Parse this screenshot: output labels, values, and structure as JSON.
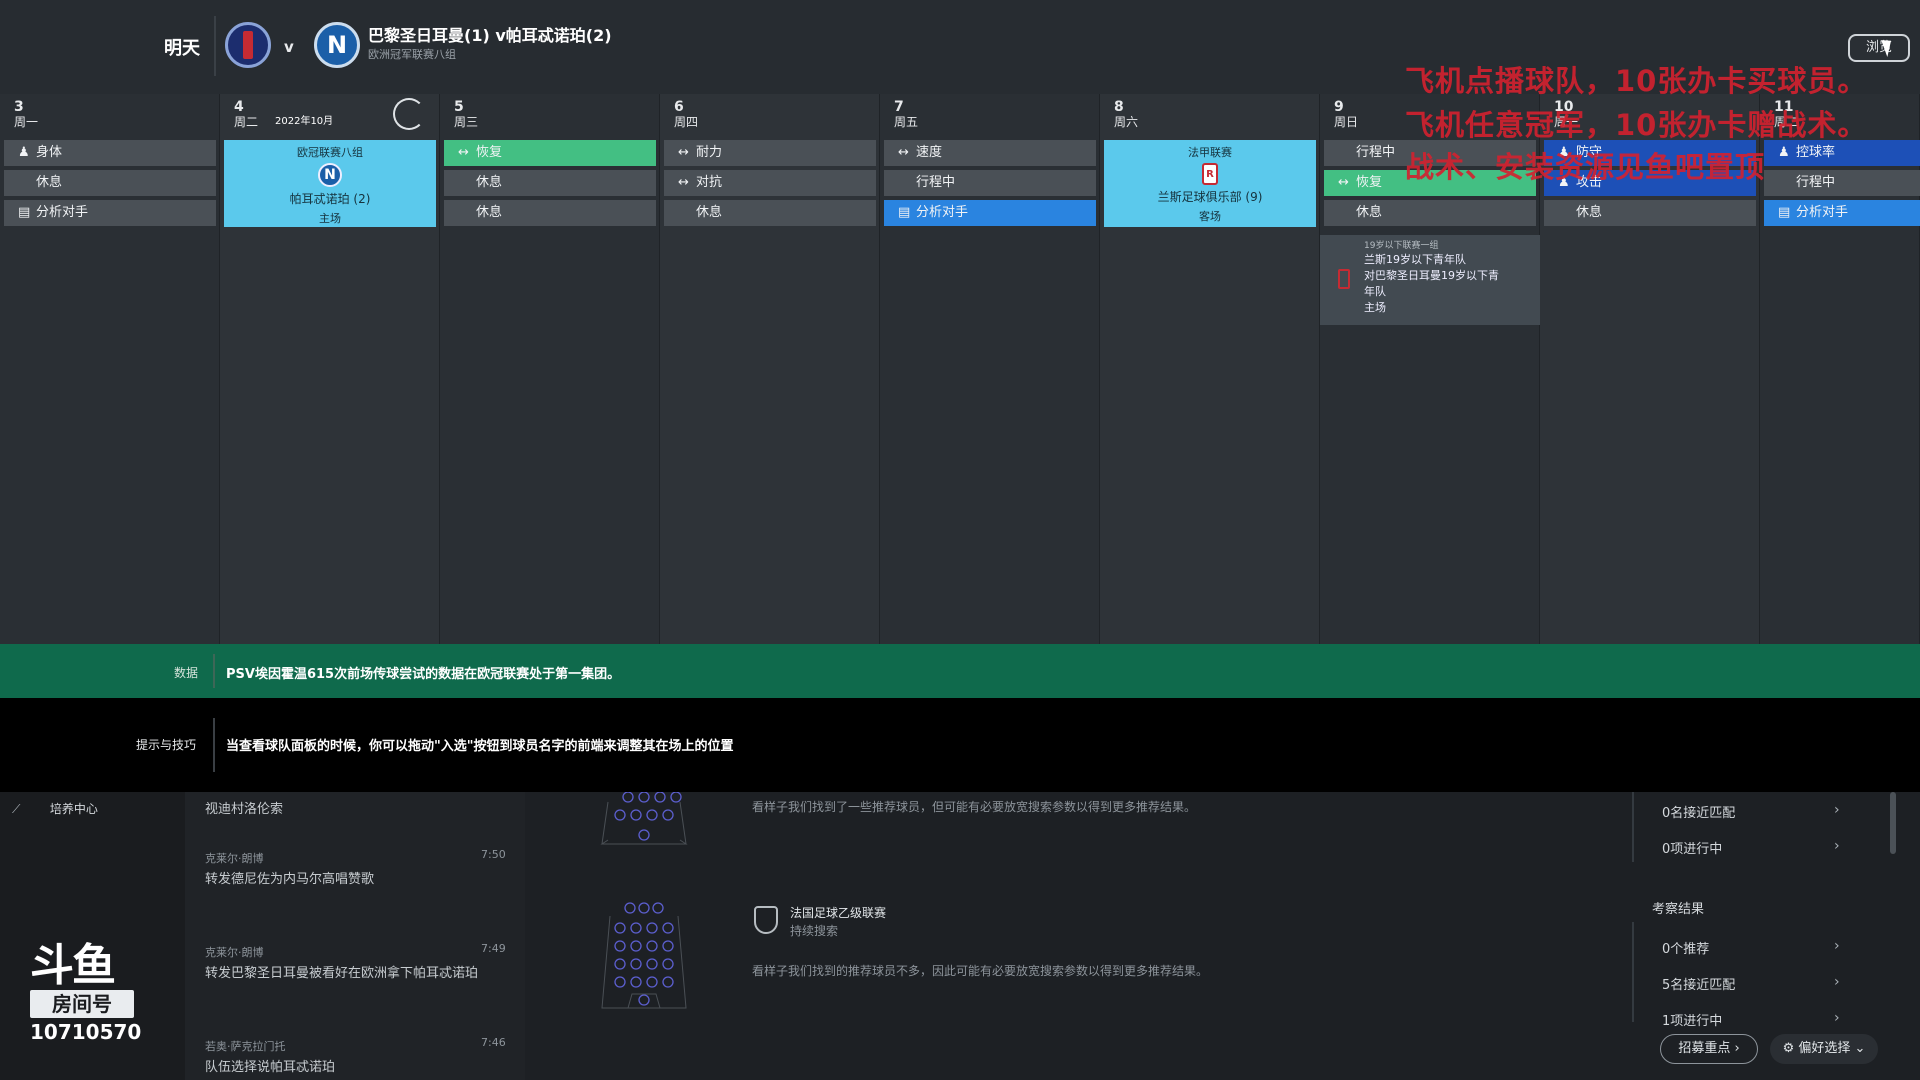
{
  "header": {
    "when": "明天",
    "vs": "v",
    "match_title": "巴黎圣日耳曼(1) v帕耳忒诺珀(2)",
    "competition": "欧洲冠军联赛八组",
    "browse_button": "浏览",
    "home_crest_icon": "psg-crest-icon",
    "away_crest_icon": "napoli-crest-icon",
    "away_crest_letter": "N"
  },
  "overlay": {
    "line1": "飞机点播球队，10张办卡买球员。",
    "line2": "飞机任意冠军，10张办卡赠战术。",
    "line3": "战术、安装资源见鱼吧置顶"
  },
  "calendar": {
    "month_label": "2022年10月",
    "days": [
      {
        "num": "3",
        "weekday": "周一",
        "rows": [
          {
            "icon": "person-icon",
            "glyph": "♟",
            "label": "身体"
          },
          {
            "label": "休息"
          },
          {
            "icon": "clipboard-icon",
            "glyph": "▤",
            "label": "分析对手"
          }
        ]
      },
      {
        "num": "4",
        "weekday": "周二",
        "match": {
          "competition": "欧冠联赛八组",
          "opponent": "帕耳忒诺珀 (2)",
          "venue": "主场",
          "badge": "N"
        }
      },
      {
        "num": "5",
        "weekday": "周三",
        "rows": [
          {
            "icon": "arrows-icon",
            "glyph": "↔",
            "label": "恢复"
          },
          {
            "label": "休息"
          },
          {
            "label": "休息"
          }
        ]
      },
      {
        "num": "6",
        "weekday": "周四",
        "rows": [
          {
            "icon": "arrows-icon",
            "glyph": "↔",
            "label": "耐力"
          },
          {
            "icon": "arrows-icon",
            "glyph": "↔",
            "label": "对抗"
          },
          {
            "label": "休息"
          }
        ]
      },
      {
        "num": "7",
        "weekday": "周五",
        "rows": [
          {
            "icon": "arrows-icon",
            "glyph": "↔",
            "label": "速度"
          },
          {
            "label": "行程中"
          },
          {
            "icon": "clipboard-icon",
            "glyph": "▤",
            "label": "分析对手"
          }
        ]
      },
      {
        "num": "8",
        "weekday": "周六",
        "match": {
          "competition": "法甲联赛",
          "opponent": "兰斯足球俱乐部 (9)",
          "venue": "客场",
          "badge": "R"
        }
      },
      {
        "num": "9",
        "weekday": "周日",
        "rows": [
          {
            "label": "行程中"
          },
          {
            "icon": "arrows-icon",
            "glyph": "↔",
            "label": "恢复"
          },
          {
            "label": "休息"
          }
        ]
      },
      {
        "num": "10",
        "weekday": "周一",
        "rows": [
          {
            "icon": "person-icon",
            "glyph": "♟",
            "label": "防守"
          },
          {
            "icon": "person-icon",
            "glyph": "♟",
            "label": "攻击"
          },
          {
            "label": "休息"
          }
        ]
      },
      {
        "num": "11",
        "weekday": "周二",
        "rows": [
          {
            "icon": "person-icon",
            "glyph": "♟",
            "label": "控球率"
          },
          {
            "label": "行程中"
          },
          {
            "icon": "clipboard-icon",
            "glyph": "▤",
            "label": "分析对手"
          }
        ]
      }
    ],
    "youth_match": {
      "group": "19岁以下联赛一组",
      "line1": "兰斯19岁以下青年队",
      "line2": "对巴黎圣日耳曼19岁以下青",
      "line3": "年队",
      "venue": "主场"
    }
  },
  "databar": {
    "label": "数据",
    "text": "PSV埃因霍温615次前场传球尝试的数据在欧冠联赛处于第一集团。"
  },
  "tipsbar": {
    "label": "提示与技巧",
    "text": "当查看球队面板的时候，你可以拖动\"入选\"按钮到球员名字的前端来调整其在场上的位置"
  },
  "sidebar": {
    "nav_item": "培养中心",
    "logo_line1": "斗鱼",
    "logo_line2": "房间号",
    "room_number": "10710570"
  },
  "news": [
    {
      "source": "",
      "time": "",
      "text": "视迪村洛伦索"
    },
    {
      "source": "克莱尔·朗博",
      "time": "7:50",
      "text": "转发德尼佐为内马尔高唱赞歌"
    },
    {
      "source": "克莱尔·朗博",
      "time": "7:49",
      "text": "转发巴黎圣日耳曼被看好在欧洲拿下帕耳忒诺珀"
    },
    {
      "source": "若奥·萨克拉门托",
      "time": "7:46",
      "text": "队伍选择说帕耳忒诺珀"
    }
  ],
  "scouting": {
    "card1_desc": "看样子我们找到了一些推荐球员，但可能有必要放宽搜索参数以得到更多推荐结果。",
    "card2_title": "法国足球乙级联赛",
    "card2_sub": "持续搜索",
    "card2_desc": "看样子我们找到的推荐球员不多，因此可能有必要放宽搜索参数以得到更多推荐结果。"
  },
  "results_panel": {
    "top_items": [
      "0名接近匹配",
      "0项进行中"
    ],
    "section_title": "考察结果",
    "items": [
      "0个推荐",
      "5名接近匹配",
      "1项进行中"
    ],
    "recruit_button": "招募重点",
    "pref_button": "偏好选择"
  },
  "colors": {
    "green_row": "#43bf83",
    "blue_row": "#2a84e0",
    "dark_blue_row": "#1d50b7",
    "match_card": "#5bc9ec",
    "data_bar": "#0f6a4c",
    "overlay_red": "#d4212f"
  }
}
